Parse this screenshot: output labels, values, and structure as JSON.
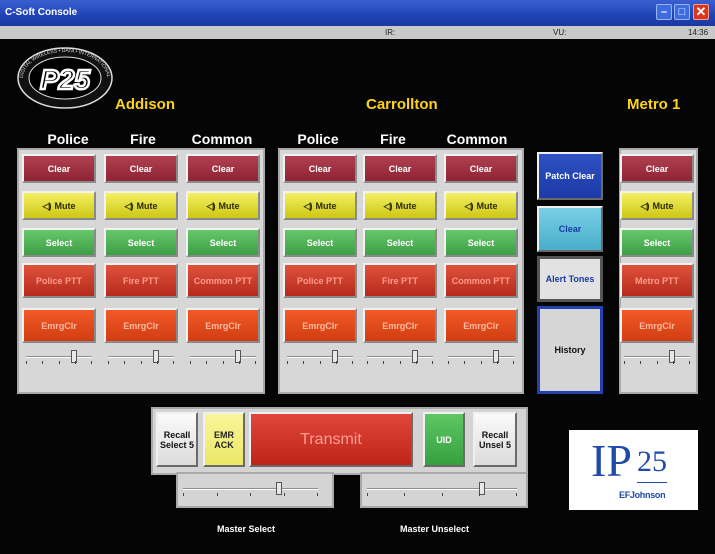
{
  "window": {
    "title": "C-Soft Console"
  },
  "status": {
    "ir_label": "IR:",
    "vu_label": "VU:",
    "time": "14:36"
  },
  "logo": {
    "text": "P25",
    "ring_text": "DIGITAL WIRELESS • DATA • INTERNATIONAL • STANDARDS"
  },
  "groups": [
    {
      "title": "Addison",
      "columns": [
        {
          "label": "Police",
          "clear": "Clear",
          "mute": "Mute",
          "select": "Select",
          "ptt": "Police PTT",
          "emrg": "EmrgClr",
          "level": 0.75
        },
        {
          "label": "Fire",
          "clear": "Clear",
          "mute": "Mute",
          "select": "Select",
          "ptt": "Fire PTT",
          "emrg": "EmrgClr",
          "level": 0.75
        },
        {
          "label": "Common",
          "clear": "Clear",
          "mute": "Mute",
          "select": "Select",
          "ptt": "Common PTT",
          "emrg": "EmrgClr",
          "level": 0.75
        }
      ]
    },
    {
      "title": "Carrollton",
      "columns": [
        {
          "label": "Police",
          "clear": "Clear",
          "mute": "Mute",
          "select": "Select",
          "ptt": "Police PTT",
          "emrg": "EmrgClr",
          "level": 0.75
        },
        {
          "label": "Fire",
          "clear": "Clear",
          "mute": "Mute",
          "select": "Select",
          "ptt": "Fire PTT",
          "emrg": "EmrgClr",
          "level": 0.75
        },
        {
          "label": "Common",
          "clear": "Clear",
          "mute": "Mute",
          "select": "Select",
          "ptt": "Common PTT",
          "emrg": "EmrgClr",
          "level": 0.75
        }
      ]
    },
    {
      "title": "Metro 1",
      "columns": [
        {
          "label": "",
          "clear": "Clear",
          "mute": "Mute",
          "select": "Select",
          "ptt": "Metro PTT",
          "emrg": "EmrgClr",
          "level": 0.75
        }
      ]
    }
  ],
  "side": {
    "patch_clear": "Patch Clear",
    "clear": "Clear",
    "alert_tones": "Alert Tones",
    "history": "History"
  },
  "transmit": {
    "recall_select": "Recall Select 5",
    "emr_ack": "EMR ACK",
    "transmit": "Transmit",
    "uid": "UID",
    "recall_unsel": "Recall Unsel 5"
  },
  "master": {
    "select_label": "Master Select",
    "unselect_label": "Master Unselect",
    "select_level": 0.72,
    "unselect_level": 0.78
  },
  "brand": {
    "ip25": "IP25",
    "ip": "IP",
    "num": "25",
    "efjohnson": "EFJohnson"
  },
  "colors": {
    "title_bar": "#1f43b5",
    "group_title": "#ffd21a",
    "clear": "#8e2434",
    "mute": "#cdc714",
    "select": "#3e9e46",
    "ptt": "#b52a1c",
    "emrg": "#d13d12",
    "transmit": "#c8281c",
    "uid": "#3fa546",
    "emr_ack": "#f3f07c",
    "patch_clear": "#1c3aa8",
    "side_clear": "#57b9d4"
  }
}
